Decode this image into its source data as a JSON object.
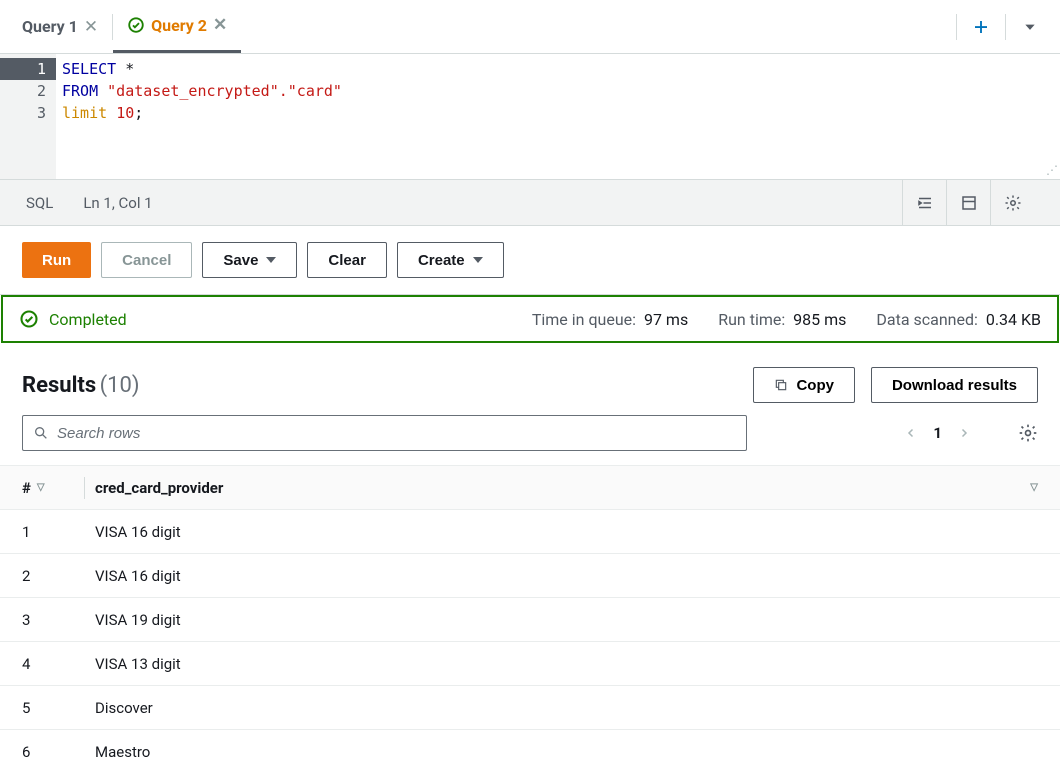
{
  "tabs": {
    "items": [
      {
        "label": "Query 1",
        "active": false,
        "status": "none"
      },
      {
        "label": "Query 2",
        "active": true,
        "status": "success"
      }
    ]
  },
  "editor": {
    "line1_kw": "SELECT ",
    "line1_rest": "*",
    "line2_kw": "FROM ",
    "line2_str": "\"dataset_encrypted\".\"card\"",
    "line3_kw": "limit ",
    "line3_num": "10",
    "line3_semi": ";"
  },
  "status_bar": {
    "lang": "SQL",
    "pos": "Ln 1, Col 1"
  },
  "toolbar": {
    "run": "Run",
    "cancel": "Cancel",
    "save": "Save",
    "clear": "Clear",
    "create": "Create"
  },
  "banner": {
    "label": "Completed",
    "queue_label": "Time in queue:",
    "queue_value": "97 ms",
    "runtime_label": "Run time:",
    "runtime_value": "985 ms",
    "scanned_label": "Data scanned:",
    "scanned_value": "0.34 KB"
  },
  "results": {
    "title": "Results",
    "count": "(10)",
    "copy": "Copy",
    "download": "Download results",
    "search_placeholder": "Search rows",
    "page": "1",
    "columns": {
      "idx": "#",
      "c1": "cred_card_provider"
    },
    "rows": [
      {
        "idx": "1",
        "v": "VISA 16 digit"
      },
      {
        "idx": "2",
        "v": "VISA 16 digit"
      },
      {
        "idx": "3",
        "v": "VISA 19 digit"
      },
      {
        "idx": "4",
        "v": "VISA 13 digit"
      },
      {
        "idx": "5",
        "v": "Discover"
      },
      {
        "idx": "6",
        "v": "Maestro"
      }
    ]
  }
}
